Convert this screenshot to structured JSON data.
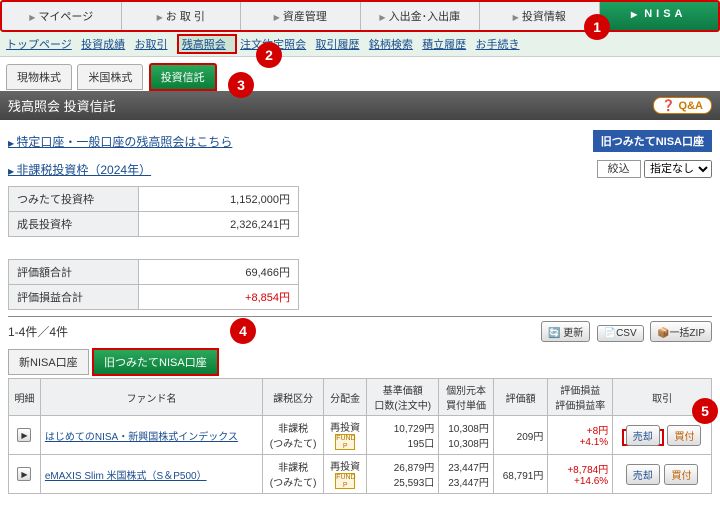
{
  "nav": {
    "items": [
      "マイページ",
      "お 取 引",
      "資産管理",
      "入出金･入出庫",
      "投資情報",
      "NISA"
    ]
  },
  "subnav": {
    "items": [
      "トップページ",
      "投資成績",
      "お取引",
      "残高照会",
      "注文約定照会",
      "取引履歴",
      "銘柄検索",
      "積立履歴",
      "お手続き"
    ],
    "active": "残高照会"
  },
  "typetabs": {
    "items": [
      "現物株式",
      "米国株式",
      "投資信託"
    ],
    "active": "投資信託"
  },
  "section": {
    "title": "残高照会 投資信託",
    "qa": "Q&A"
  },
  "links": {
    "special": "特定口座・一般口座の残高照会はこちら",
    "oldnisa": "旧つみたてNISA口座",
    "nontax": "非課税投資枠（2024年）"
  },
  "filter": {
    "label": "絞込",
    "value": "指定なし"
  },
  "quota": {
    "rows": [
      {
        "h": "つみたて投資枠",
        "v": "1,152,000円"
      },
      {
        "h": "成長投資枠",
        "v": "2,326,241円"
      }
    ]
  },
  "totals": {
    "rows": [
      {
        "h": "評価額合計",
        "v": "69,466円",
        "pos": false
      },
      {
        "h": "評価損益合計",
        "v": "+8,854円",
        "pos": true
      }
    ]
  },
  "pager": {
    "range": "1-4件／4件",
    "update": "更新",
    "csv": "CSV",
    "zip": "一括ZIP"
  },
  "accttabs": {
    "items": [
      "新NISA口座",
      "旧つみたてNISA口座"
    ],
    "active": "旧つみたてNISA口座"
  },
  "grid": {
    "head": {
      "detail": "明細",
      "fund": "ファンド名",
      "tax": "課税区分",
      "dist": "分配金",
      "base": "基準価額\n口数(注文中)",
      "unit": "個別元本\n買付単価",
      "val": "評価額",
      "pl": "評価損益\n評価損益率",
      "trade": "取引"
    },
    "rows": [
      {
        "fund": "はじめてのNISA・新興国株式インデックス",
        "tax1": "非課税",
        "tax2": "(つみたて)",
        "dist": "再投資",
        "base1": "10,729円",
        "base2": "195口",
        "unit1": "10,308円",
        "unit2": "10,308円",
        "val": "209円",
        "pl1": "+8円",
        "pl2": "+4.1%",
        "sell": "売却",
        "buy": "買付"
      },
      {
        "fund": "eMAXIS Slim 米国株式（S＆P500）",
        "tax1": "非課税",
        "tax2": "(つみたて)",
        "dist": "再投資",
        "base1": "26,879円",
        "base2": "25,593口",
        "unit1": "23,447円",
        "unit2": "23,447円",
        "val": "68,791円",
        "pl1": "+8,784円",
        "pl2": "+14.6%",
        "sell": "売却",
        "buy": "買付"
      }
    ]
  },
  "callouts": {
    "c1": "1",
    "c2": "2",
    "c3": "3",
    "c4": "4",
    "c5": "5"
  }
}
